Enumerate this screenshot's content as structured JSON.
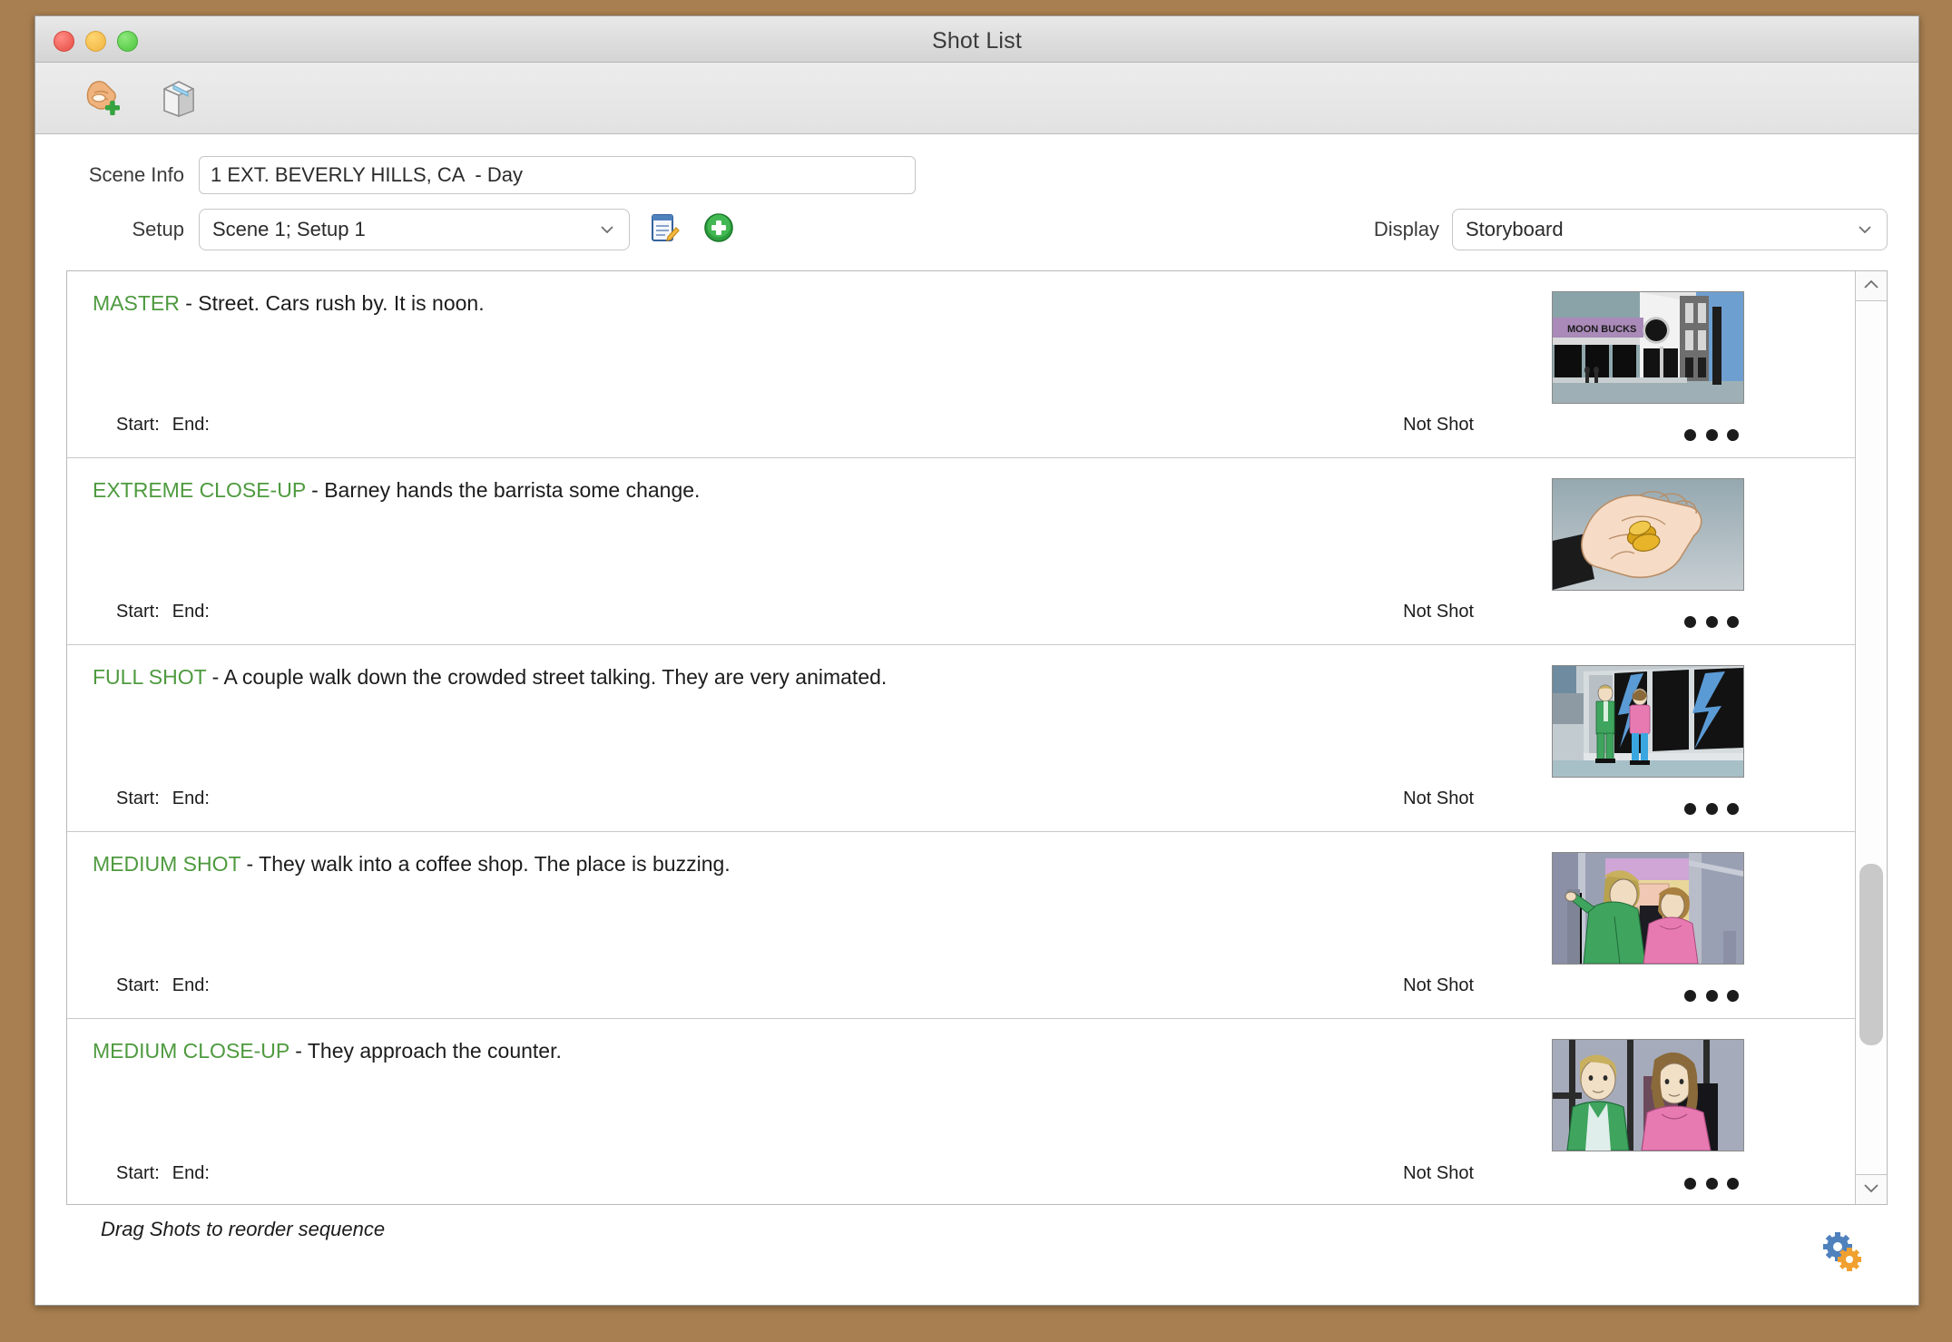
{
  "window": {
    "title": "Shot List",
    "traffic_lights": [
      "close",
      "minimize",
      "maximize"
    ]
  },
  "toolbar": {
    "buttons": [
      {
        "name": "add-shot",
        "icon": "hand-plus-icon"
      },
      {
        "name": "storyboard-box",
        "icon": "box-icon"
      }
    ]
  },
  "scene": {
    "label": "Scene Info",
    "value": "1 EXT. BEVERLY HILLS, CA  - Day",
    "placeholder": ""
  },
  "setup": {
    "label": "Setup",
    "value": "Scene 1; Setup 1",
    "edit_icon": "notepad-edit-icon",
    "add_icon": "green-plus-icon"
  },
  "display": {
    "label": "Display",
    "value": "Storyboard"
  },
  "list": {
    "labels": {
      "start": "Start:",
      "end": "End:",
      "status": "Not Shot",
      "menu": "row-menu-ellipsis"
    },
    "shots": [
      {
        "type": "MASTER",
        "separator": " - ",
        "text": "Street. Cars rush by. It is noon.",
        "start": "",
        "end": "",
        "status": "Not Shot",
        "thumb": "street-moonbucks-corner"
      },
      {
        "type": "EXTREME CLOSE-UP",
        "separator": " - ",
        "text": "Barney hands the barrista some change.",
        "start": "",
        "end": "",
        "status": "Not Shot",
        "thumb": "hand-with-coins"
      },
      {
        "type": "FULL SHOT",
        "separator": " - ",
        "text": "A couple walk down the crowded street talking. They are very animated.",
        "start": "",
        "end": "",
        "status": "Not Shot",
        "thumb": "couple-walking-storefront"
      },
      {
        "type": "MEDIUM SHOT",
        "separator": " - ",
        "text": "They walk into a coffee shop. The place is buzzing.",
        "start": "",
        "end": "",
        "status": "Not Shot",
        "thumb": "couple-entering-door"
      },
      {
        "type": "MEDIUM CLOSE-UP",
        "separator": " - ",
        "text": "They approach the counter.",
        "start": "",
        "end": "",
        "status": "Not Shot",
        "thumb": "couple-closeup-counter"
      }
    ]
  },
  "footer": {
    "hint": "Drag Shots to reorder sequence",
    "settings_icon": "gears-icon"
  },
  "colors": {
    "shot_type_green": "#4e9a3f",
    "desktop_brown": "#a87f50",
    "accent_green_plus": "#2e9e3e",
    "gear_blue": "#4f81bd",
    "gear_orange": "#f0a030"
  }
}
